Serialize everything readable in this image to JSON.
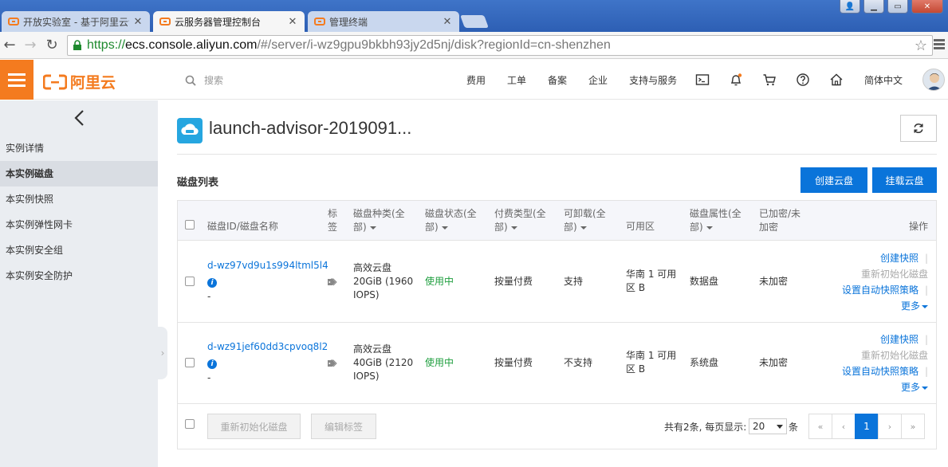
{
  "browser": {
    "tabs": [
      {
        "title": "开放实验室 - 基于阿里云创",
        "state": "inactive"
      },
      {
        "title": "云服务器管理控制台",
        "state": "active"
      },
      {
        "title": "管理终端",
        "state": "inactive"
      }
    ],
    "url": {
      "scheme": "https://",
      "host": "ecs.console.aliyun.com",
      "path": "/#/server/i-wz9gpu9bkbh93jy2d5nj/disk?regionId=cn-shenzhen"
    }
  },
  "header": {
    "logo_text": "阿里云",
    "search_placeholder": "搜索",
    "nav": [
      "费用",
      "工单",
      "备案",
      "企业",
      "支持与服务"
    ],
    "icons": [
      "terminal-icon",
      "bell-icon",
      "cart-icon",
      "help-icon",
      "home-icon"
    ],
    "language": "简体中文",
    "brand_color": "#f47b1f"
  },
  "sidebar": {
    "items": [
      {
        "label": "实例详情",
        "active": false
      },
      {
        "label": "本实例磁盘",
        "active": true
      },
      {
        "label": "本实例快照",
        "active": false
      },
      {
        "label": "本实例弹性网卡",
        "active": false
      },
      {
        "label": "本实例安全组",
        "active": false
      },
      {
        "label": "本实例安全防护",
        "active": false
      }
    ]
  },
  "main": {
    "instance_title": "launch-advisor-2019091...",
    "section_title": "磁盘列表",
    "create_button": "创建云盘",
    "attach_button": "挂载云盘",
    "accent_color": "#0a74da",
    "columns": {
      "disk_id": "磁盘ID/磁盘名称",
      "tag_line1": "标",
      "tag_line2": "签",
      "type_line1": "磁盘种类(全",
      "type_line2": "部)",
      "status_line1": "磁盘状态(全",
      "status_line2": "部)",
      "billing_line1": "付费类型(全",
      "billing_line2": "部)",
      "detach_line1": "可卸载(全",
      "detach_line2": "部)",
      "zone": "可用区",
      "attr_line1": "磁盘属性(全",
      "attr_line2": "部)",
      "enc_line1": "已加密/未",
      "enc_line2": "加密",
      "ops": "操作"
    },
    "rows": [
      {
        "id": "d-wz97vd9u1s994ltml5l4",
        "name": "-",
        "type": "高效云盘",
        "size_line1": "20GiB (1960",
        "size_line2": "IOPS)",
        "status": "使用中",
        "billing": "按量付费",
        "detachable": "支持",
        "zone_line1": "华南 1 可用",
        "zone_line2": "区 B",
        "attribute": "数据盘",
        "encrypted": "未加密",
        "ops": {
          "snapshot": "创建快照",
          "reinit": "重新初始化磁盘",
          "policy": "设置自动快照策略",
          "more": "更多"
        }
      },
      {
        "id": "d-wz91jef60dd3cpvoq8l2",
        "name": "-",
        "type": "高效云盘",
        "size_line1": "40GiB (2120",
        "size_line2": "IOPS)",
        "status": "使用中",
        "billing": "按量付费",
        "detachable": "不支持",
        "zone_line1": "华南 1 可用",
        "zone_line2": "区 B",
        "attribute": "系统盘",
        "encrypted": "未加密",
        "ops": {
          "snapshot": "创建快照",
          "reinit": "重新初始化磁盘",
          "policy": "设置自动快照策略",
          "more": "更多"
        }
      }
    ],
    "footer": {
      "reinit_button": "重新初始化磁盘",
      "edit_tags_button": "编辑标签",
      "total_text": "共有2条, 每页显示:",
      "page_size": "20",
      "unit": "条",
      "pager": [
        "«",
        "‹",
        "1",
        "›",
        "»"
      ],
      "current_page": "1"
    }
  }
}
